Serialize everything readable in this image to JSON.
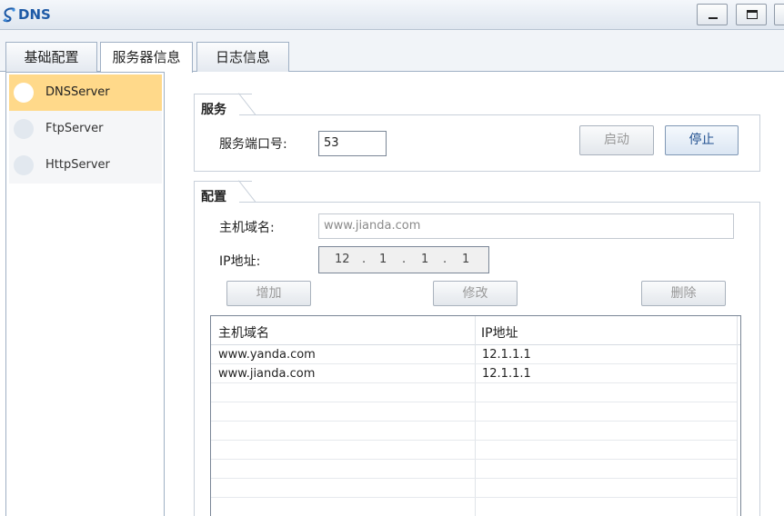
{
  "window": {
    "title": "DNS"
  },
  "tabs": [
    {
      "label": "基础配置"
    },
    {
      "label": "服务器信息"
    },
    {
      "label": "日志信息"
    }
  ],
  "sidebar": {
    "items": [
      {
        "label": "DNSServer",
        "selected": true
      },
      {
        "label": "FtpServer",
        "selected": false
      },
      {
        "label": "HttpServer",
        "selected": false
      }
    ]
  },
  "service": {
    "title": "服务",
    "port_label": "服务端口号:",
    "port_value": "53",
    "start_label": "启动",
    "stop_label": "停止"
  },
  "config": {
    "title": "配置",
    "domain_label": "主机域名:",
    "domain_placeholder": "www.jianda.com",
    "ip_label": "IP地址:",
    "ip_parts": [
      "12",
      "1",
      "1",
      "1"
    ],
    "add_label": "增加",
    "modify_label": "修改",
    "delete_label": "删除"
  },
  "table": {
    "headers": [
      "主机域名",
      "IP地址"
    ],
    "rows": [
      [
        "www.yanda.com",
        "12.1.1.1"
      ],
      [
        "www.jianda.com",
        "12.1.1.1"
      ]
    ]
  },
  "colors": {
    "selected_item": "#ffd98a",
    "title_blue": "#1e5aa6"
  }
}
